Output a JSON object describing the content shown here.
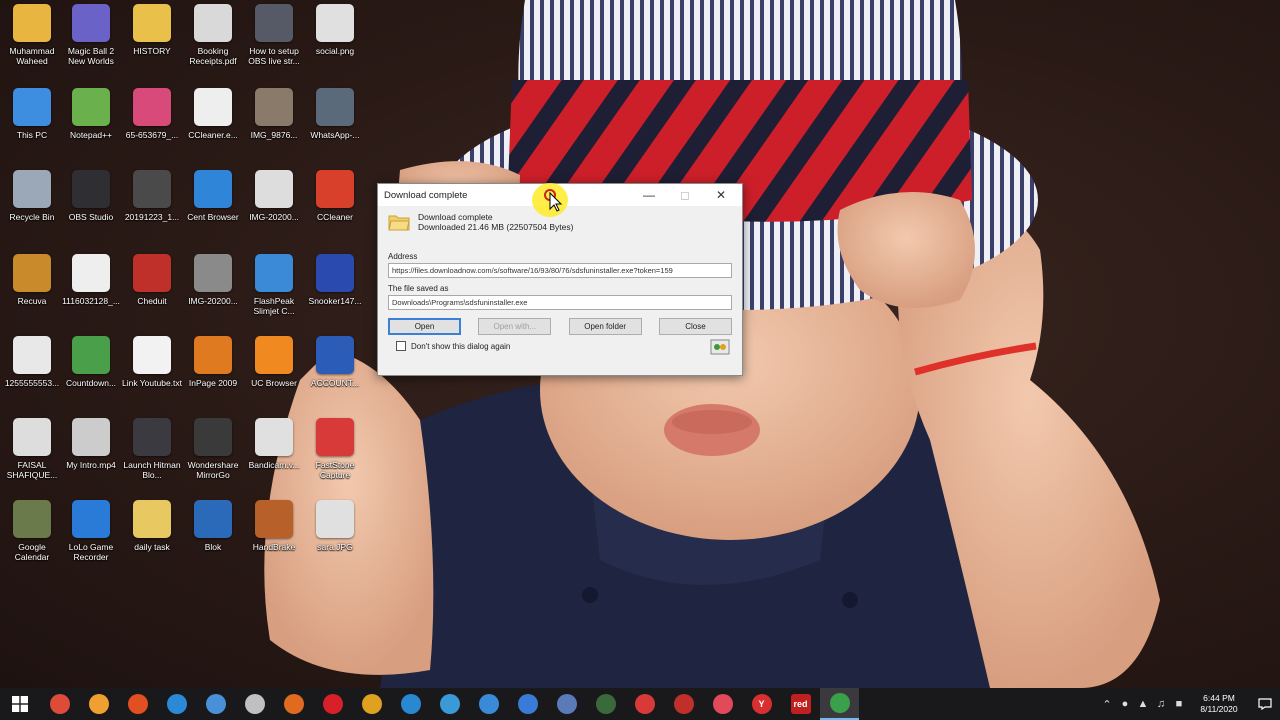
{
  "desktop": {
    "icons": [
      {
        "label": "Muhammad Waheed",
        "glyph": "",
        "color": "#e8b640"
      },
      {
        "label": "Magic Ball 2 New Worlds",
        "glyph": "",
        "color": "#6b62c8"
      },
      {
        "label": "HISTORY",
        "glyph": "",
        "color": "#e8c04a"
      },
      {
        "label": "Booking Receipts.pdf",
        "glyph": "",
        "color": "#d9d9d9"
      },
      {
        "label": "How to setup OBS live str...",
        "glyph": "",
        "color": "#555a66"
      },
      {
        "label": "social.png",
        "glyph": "",
        "color": "#e0e0e0"
      },
      {
        "label": "This PC",
        "glyph": "",
        "color": "#3d8ee0"
      },
      {
        "label": "Notepad++",
        "glyph": "",
        "color": "#6ab04c"
      },
      {
        "label": "65-653679_...",
        "glyph": "",
        "color": "#d84a7a"
      },
      {
        "label": "CCleaner.e...",
        "glyph": "",
        "color": "#eeeeee"
      },
      {
        "label": "IMG_9876...",
        "glyph": "",
        "color": "#8a7a6a"
      },
      {
        "label": "WhatsApp-...",
        "glyph": "",
        "color": "#5a6a7a"
      },
      {
        "label": "Recycle Bin",
        "glyph": "",
        "color": "#9aa8b8"
      },
      {
        "label": "OBS Studio",
        "glyph": "",
        "color": "#2e2e33"
      },
      {
        "label": "20191223_1...",
        "glyph": "",
        "color": "#4a4a4a"
      },
      {
        "label": "Cent Browser",
        "glyph": "",
        "color": "#2f86d8"
      },
      {
        "label": "IMG-20200...",
        "glyph": "",
        "color": "#dddddd"
      },
      {
        "label": "CCleaner",
        "glyph": "",
        "color": "#d8402c"
      },
      {
        "label": "Recuva",
        "glyph": "",
        "color": "#c88a2a"
      },
      {
        "label": "1116032128_...",
        "glyph": "",
        "color": "#eeeeee"
      },
      {
        "label": "Cheduit",
        "glyph": "",
        "color": "#c0302a"
      },
      {
        "label": "IMG-20200...",
        "glyph": "",
        "color": "#8a8a8a"
      },
      {
        "label": "FlashPeak Slimjet C...",
        "glyph": "",
        "color": "#3a8ad8"
      },
      {
        "label": "Snooker147...",
        "glyph": "",
        "color": "#2a4ab0"
      },
      {
        "label": "1255555553...",
        "glyph": "",
        "color": "#e8e8e8"
      },
      {
        "label": "Countdown...",
        "glyph": "",
        "color": "#4aa04a"
      },
      {
        "label": "Link Youtube.txt",
        "glyph": "",
        "color": "#f2f2f2"
      },
      {
        "label": "InPage 2009",
        "glyph": "",
        "color": "#e07a20"
      },
      {
        "label": "UC Browser",
        "glyph": "",
        "color": "#f08a20"
      },
      {
        "label": "ACCOUNT...",
        "glyph": "",
        "color": "#2b5cb8"
      },
      {
        "label": "FAISAL SHAFIQUE...",
        "glyph": "",
        "color": "#dddddd"
      },
      {
        "label": "My Intro.mp4",
        "glyph": "",
        "color": "#cccccc"
      },
      {
        "label": "Launch Hitman Blo...",
        "glyph": "",
        "color": "#3a3a40"
      },
      {
        "label": "Wondershare MirrorGo",
        "glyph": "",
        "color": "#3a3a3a"
      },
      {
        "label": "Bandicam.v...",
        "glyph": "",
        "color": "#e0e0e0"
      },
      {
        "label": "FastStone Capture",
        "glyph": "",
        "color": "#d83a3a"
      },
      {
        "label": "Google Calendar",
        "glyph": "",
        "color": "#6a7a4a"
      },
      {
        "label": "LoLo Game Recorder",
        "glyph": "",
        "color": "#2a7ad8"
      },
      {
        "label": "daily task",
        "glyph": "",
        "color": "#e8c860"
      },
      {
        "label": "Blok",
        "glyph": "",
        "color": "#2a6ab8"
      },
      {
        "label": "HandBrake",
        "glyph": "",
        "color": "#b8602a"
      },
      {
        "label": "sara.JPG",
        "glyph": "",
        "color": "#e0e0e0"
      }
    ]
  },
  "dialog": {
    "title": "Download complete",
    "line1": "Download complete",
    "line2": "Downloaded 21.46 MB (22507504 Bytes)",
    "address_label": "Address",
    "address_value": "https://files.downloadnow.com/s/software/16/93/80/76/sdsfuninstaller.exe?token=159",
    "saved_label": "The file saved as",
    "saved_value": "Downloads\\Programs\\sdsfuninstaller.exe",
    "btn_open": "Open",
    "btn_open_with": "Open with...",
    "btn_open_folder": "Open folder",
    "btn_close": "Close",
    "dont_show": "Don't show this dialog again"
  },
  "taskbar": {
    "apps": [
      {
        "name": "chrome",
        "color": "#dd4b39"
      },
      {
        "name": "app2",
        "color": "#f0a030"
      },
      {
        "name": "brave",
        "color": "#e05020"
      },
      {
        "name": "edge",
        "color": "#2a8ad8"
      },
      {
        "name": "chromium",
        "color": "#4a90d8"
      },
      {
        "name": "ie",
        "color": "#c0c0c0"
      },
      {
        "name": "firefox",
        "color": "#e06a20"
      },
      {
        "name": "opera",
        "color": "#d8202a"
      },
      {
        "name": "chrome-canary",
        "color": "#e0a020"
      },
      {
        "name": "cent",
        "color": "#2a88d0"
      },
      {
        "name": "browser",
        "color": "#3a9ad8"
      },
      {
        "name": "slimjet",
        "color": "#3a8ad8"
      },
      {
        "name": "chrome-beta",
        "color": "#3a7ad8"
      },
      {
        "name": "app",
        "color": "#5a7ab8"
      },
      {
        "name": "torch",
        "color": "#3a6a3a"
      },
      {
        "name": "vivaldi",
        "color": "#d83a3a"
      },
      {
        "name": "rockmelt",
        "color": "#c0302a"
      },
      {
        "name": "opera-gx",
        "color": "#e04a5a"
      },
      {
        "name": "yandex",
        "color": "#d83030"
      },
      {
        "name": "red",
        "color": "#c02020"
      },
      {
        "name": "internet-download",
        "color": "#3aa04a"
      }
    ],
    "red_label": "red",
    "yandex_label": "Y",
    "time": "6:44 PM",
    "date": "8/11/2020"
  }
}
